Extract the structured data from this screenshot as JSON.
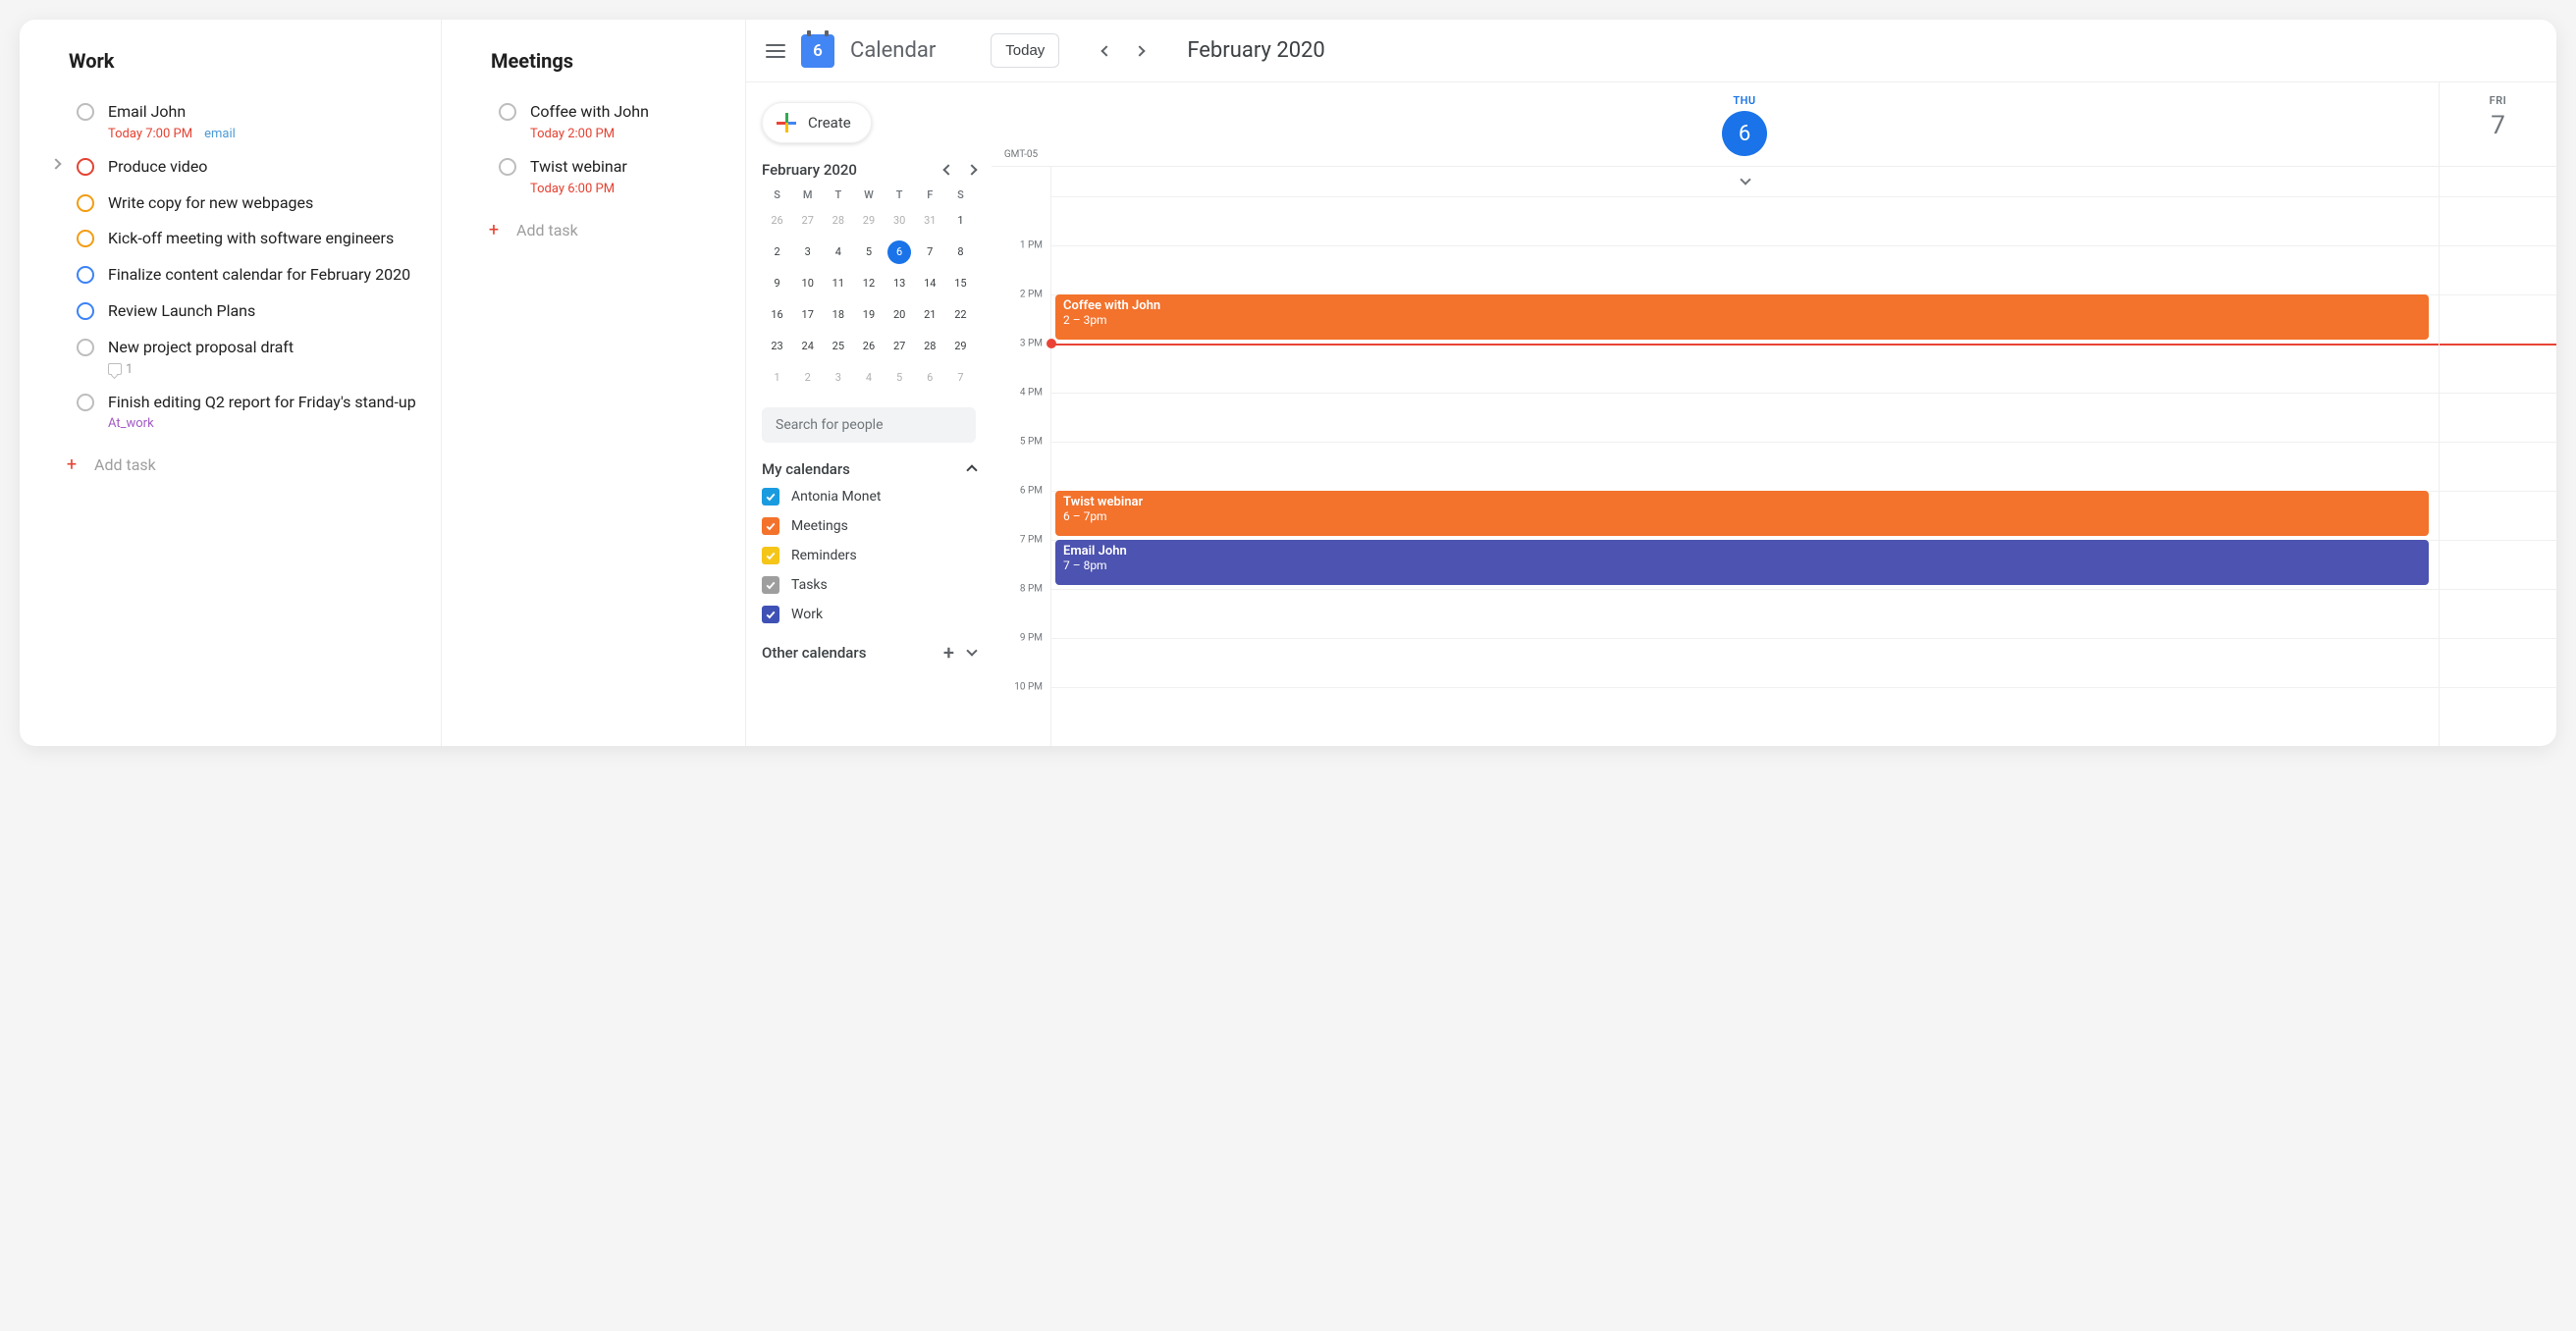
{
  "panels": {
    "work": {
      "title": "Work",
      "addTask": "Add task",
      "tasks": [
        {
          "title": "Email John",
          "circle": "gray",
          "meta": [
            {
              "text": "Today 7:00 PM",
              "cls": "meta-red"
            },
            {
              "text": "email",
              "cls": "meta-blue"
            }
          ]
        },
        {
          "title": "Produce video",
          "circle": "red",
          "chevron": true
        },
        {
          "title": "Write copy for new webpages",
          "circle": "orange"
        },
        {
          "title": "Kick-off meeting with software engineers",
          "circle": "orange"
        },
        {
          "title": "Finalize content calendar for February 2020",
          "circle": "blue"
        },
        {
          "title": "Review Launch Plans",
          "circle": "blue"
        },
        {
          "title": "New project proposal draft",
          "circle": "gray",
          "comment": "1"
        },
        {
          "title": "Finish editing Q2 report for Friday's stand-up",
          "circle": "gray",
          "meta": [
            {
              "text": "At_work",
              "cls": "meta-purple"
            }
          ]
        }
      ]
    },
    "meetings": {
      "title": "Meetings",
      "addTask": "Add task",
      "tasks": [
        {
          "title": "Coffee with John",
          "circle": "gray",
          "meta": [
            {
              "text": "Today 2:00 PM",
              "cls": "meta-red"
            }
          ]
        },
        {
          "title": "Twist webinar",
          "circle": "gray",
          "meta": [
            {
              "text": "Today 6:00 PM",
              "cls": "meta-red"
            }
          ]
        }
      ]
    }
  },
  "gcal": {
    "brand": "Calendar",
    "logoDay": "6",
    "todayBtn": "Today",
    "monthTitle": "February 2020",
    "createLabel": "Create",
    "mini": {
      "title": "February 2020",
      "dow": [
        "S",
        "M",
        "T",
        "W",
        "T",
        "F",
        "S"
      ],
      "weeks": [
        [
          {
            "n": "26",
            "f": 1
          },
          {
            "n": "27",
            "f": 1
          },
          {
            "n": "28",
            "f": 1
          },
          {
            "n": "29",
            "f": 1
          },
          {
            "n": "30",
            "f": 1
          },
          {
            "n": "31",
            "f": 1
          },
          {
            "n": "1"
          }
        ],
        [
          {
            "n": "2"
          },
          {
            "n": "3"
          },
          {
            "n": "4"
          },
          {
            "n": "5"
          },
          {
            "n": "6",
            "today": 1
          },
          {
            "n": "7"
          },
          {
            "n": "8"
          }
        ],
        [
          {
            "n": "9"
          },
          {
            "n": "10"
          },
          {
            "n": "11"
          },
          {
            "n": "12"
          },
          {
            "n": "13"
          },
          {
            "n": "14"
          },
          {
            "n": "15"
          }
        ],
        [
          {
            "n": "16"
          },
          {
            "n": "17"
          },
          {
            "n": "18"
          },
          {
            "n": "19"
          },
          {
            "n": "20"
          },
          {
            "n": "21"
          },
          {
            "n": "22"
          }
        ],
        [
          {
            "n": "23"
          },
          {
            "n": "24"
          },
          {
            "n": "25"
          },
          {
            "n": "26"
          },
          {
            "n": "27"
          },
          {
            "n": "28"
          },
          {
            "n": "29"
          }
        ],
        [
          {
            "n": "1",
            "f": 1
          },
          {
            "n": "2",
            "f": 1
          },
          {
            "n": "3",
            "f": 1
          },
          {
            "n": "4",
            "f": 1
          },
          {
            "n": "5",
            "f": 1
          },
          {
            "n": "6",
            "f": 1
          },
          {
            "n": "7",
            "f": 1
          }
        ]
      ]
    },
    "searchPlaceholder": "Search for people",
    "myCalendarsLabel": "My calendars",
    "otherCalendarsLabel": "Other calendars",
    "calendars": [
      {
        "name": "Antonia Monet",
        "color": "chk-blue"
      },
      {
        "name": "Meetings",
        "color": "chk-orange"
      },
      {
        "name": "Reminders",
        "color": "chk-yellow"
      },
      {
        "name": "Tasks",
        "color": "chk-gray"
      },
      {
        "name": "Work",
        "color": "chk-indigo"
      }
    ],
    "schedule": {
      "tz": "GMT-05",
      "days": [
        {
          "dow": "THU",
          "num": "6",
          "today": true
        },
        {
          "dow": "FRI",
          "num": "7",
          "today": false
        }
      ],
      "startHour": 12,
      "hourHeight": 50,
      "hours": [
        "1 PM",
        "2 PM",
        "3 PM",
        "4 PM",
        "5 PM",
        "6 PM",
        "7 PM",
        "8 PM",
        "9 PM",
        "10 PM"
      ],
      "nowHour": 15,
      "events": [
        {
          "title": "Coffee with John",
          "time": "2 – 3pm",
          "color": "ev-orange",
          "start": 14,
          "end": 15
        },
        {
          "title": "Twist webinar",
          "time": "6 – 7pm",
          "color": "ev-orange",
          "start": 18,
          "end": 19
        },
        {
          "title": "Email John",
          "time": "7 – 8pm",
          "color": "ev-indigo",
          "start": 19,
          "end": 20
        }
      ]
    }
  }
}
